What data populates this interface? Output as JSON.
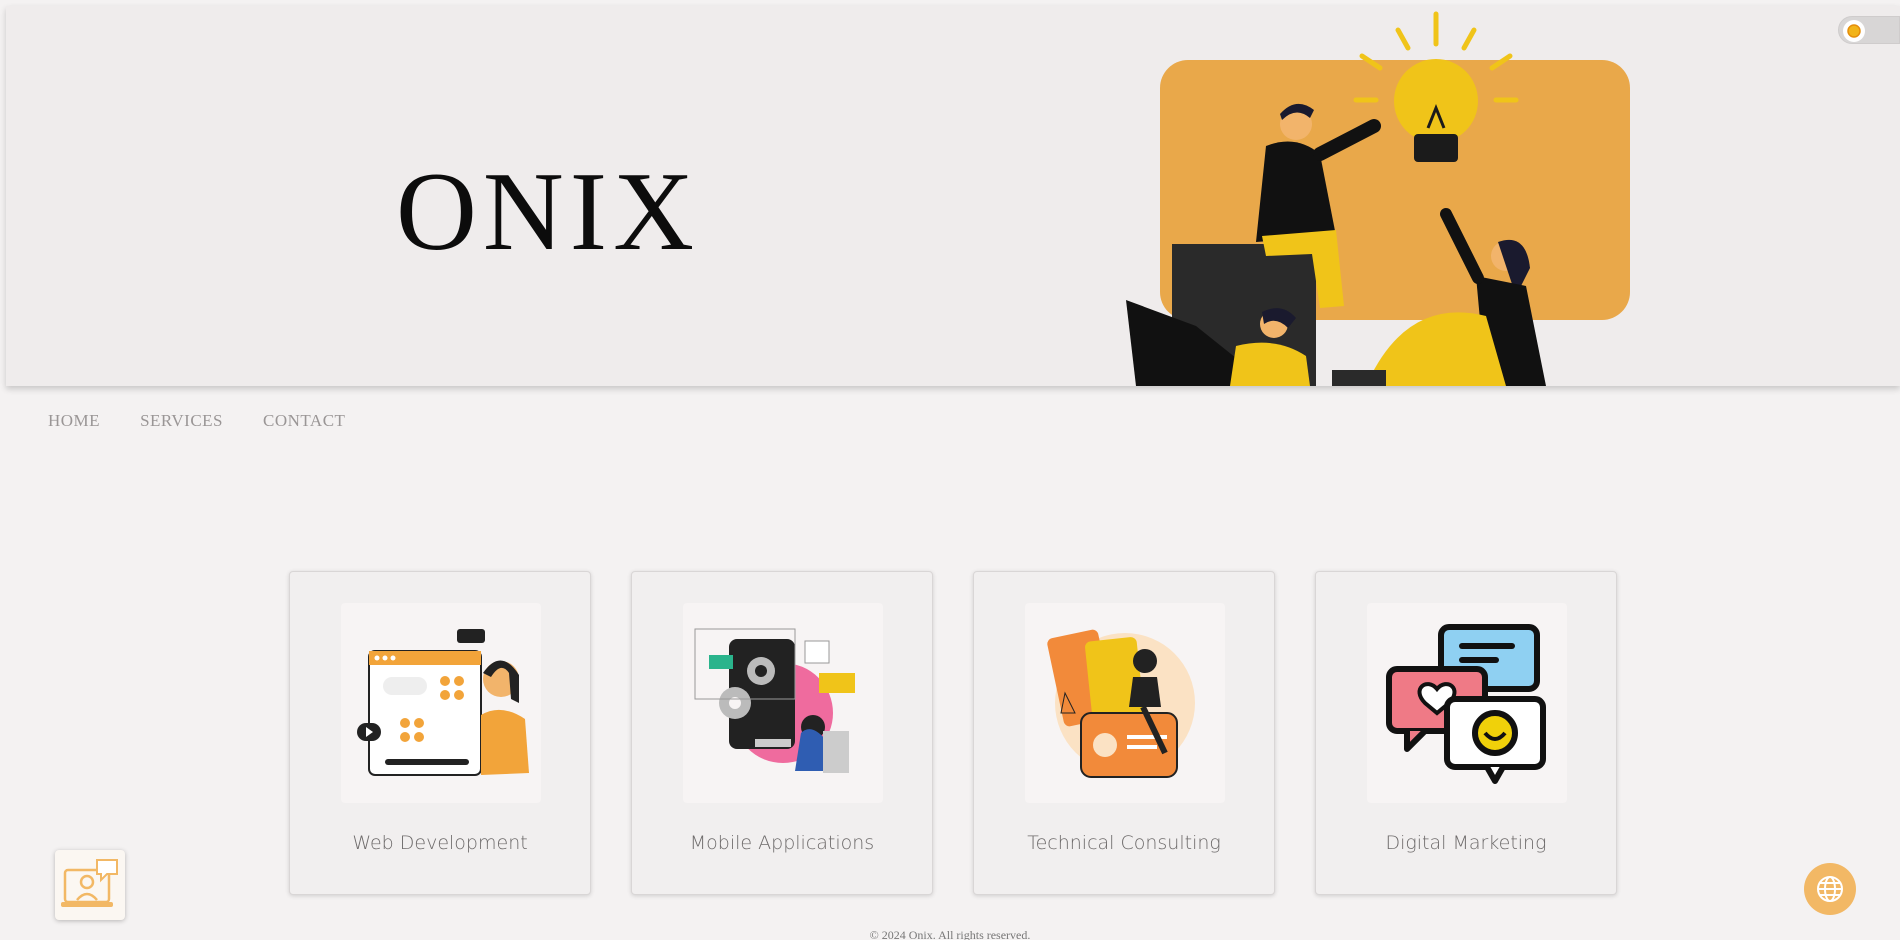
{
  "brand": {
    "title": "ONIX"
  },
  "nav": {
    "items": [
      "HOME",
      "SERVICES",
      "CONTACT"
    ]
  },
  "services": [
    {
      "label": "Web Development"
    },
    {
      "label": "Mobile Applications"
    },
    {
      "label": "Technical Consulting"
    },
    {
      "label": "Digital Marketing"
    }
  ],
  "footer": {
    "text": "© 2024 Onix. All rights reserved."
  },
  "colors": {
    "accent": "#e9a84a",
    "yellow": "#f0c419",
    "background": "#f4f2f2"
  },
  "icons": {
    "theme_toggle": "sun-icon",
    "chat_widget": "support-chat-icon",
    "language": "globe-icon"
  }
}
